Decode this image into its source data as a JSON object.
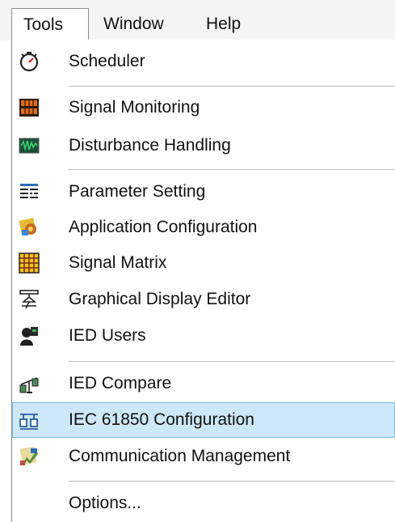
{
  "menubar": {
    "tools": "Tools",
    "window": "Window",
    "help": "Help"
  },
  "menu": {
    "items": [
      {
        "label": "Scheduler",
        "icon": "stopwatch-icon"
      },
      {
        "label": "Signal Monitoring",
        "icon": "signal-monitoring-icon"
      },
      {
        "label": "Disturbance Handling",
        "icon": "disturbance-handling-icon"
      },
      {
        "label": "Parameter Setting",
        "icon": "parameter-setting-icon"
      },
      {
        "label": "Application Configuration",
        "icon": "application-configuration-icon"
      },
      {
        "label": "Signal Matrix",
        "icon": "signal-matrix-icon"
      },
      {
        "label": "Graphical Display Editor",
        "icon": "graphical-display-editor-icon"
      },
      {
        "label": "IED Users",
        "icon": "ied-users-icon"
      },
      {
        "label": "IED Compare",
        "icon": "ied-compare-icon"
      },
      {
        "label": "IEC 61850 Configuration",
        "icon": "iec61850-configuration-icon",
        "highlighted": true
      },
      {
        "label": "Communication Management",
        "icon": "communication-management-icon"
      },
      {
        "label": "Options...",
        "icon": ""
      }
    ]
  },
  "colors": {
    "highlight": "#cde8f8",
    "highlight_border": "#7fb8de",
    "separator": "#bdbdbd"
  }
}
